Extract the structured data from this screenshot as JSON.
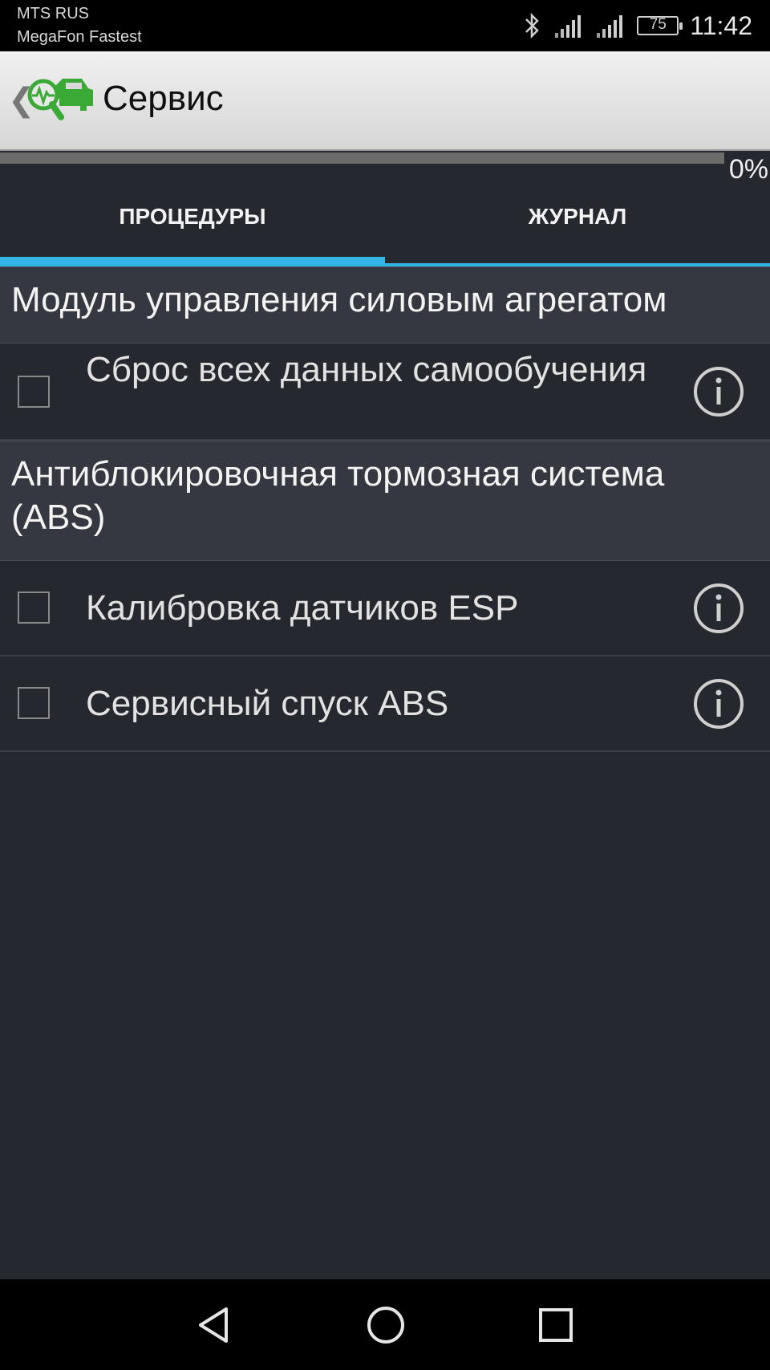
{
  "status_bar": {
    "carrier_1": "MTS RUS",
    "carrier_2": "MegaFon Fastest",
    "battery_level": "75",
    "time": "11:42",
    "icons": [
      "bluetooth-icon",
      "signal-icon",
      "signal-icon",
      "battery-icon"
    ]
  },
  "action_bar": {
    "title": "Сервис",
    "logo_icon": "car-diagnostics-icon",
    "logo_color": "#3aa935"
  },
  "progress": {
    "percent": 0,
    "label": "0%"
  },
  "tabs": [
    {
      "label": "ПРОЦЕДУРЫ",
      "selected": true
    },
    {
      "label": "ЖУРНАЛ",
      "selected": false
    }
  ],
  "accent_color": "#34b5e5",
  "sections": [
    {
      "header": "Модуль управления силовым агрегатом",
      "items": [
        {
          "label": "Сброс всех данных самообучения",
          "checked": false
        }
      ]
    },
    {
      "header": "Антиблокировочная тормозная система (ABS)",
      "items": [
        {
          "label": "Калибровка датчиков ESP",
          "checked": false
        },
        {
          "label": "Сервисный спуск ABS",
          "checked": false
        }
      ]
    }
  ],
  "nav_bar": {
    "buttons": [
      "back-icon",
      "home-icon",
      "recents-icon"
    ]
  }
}
